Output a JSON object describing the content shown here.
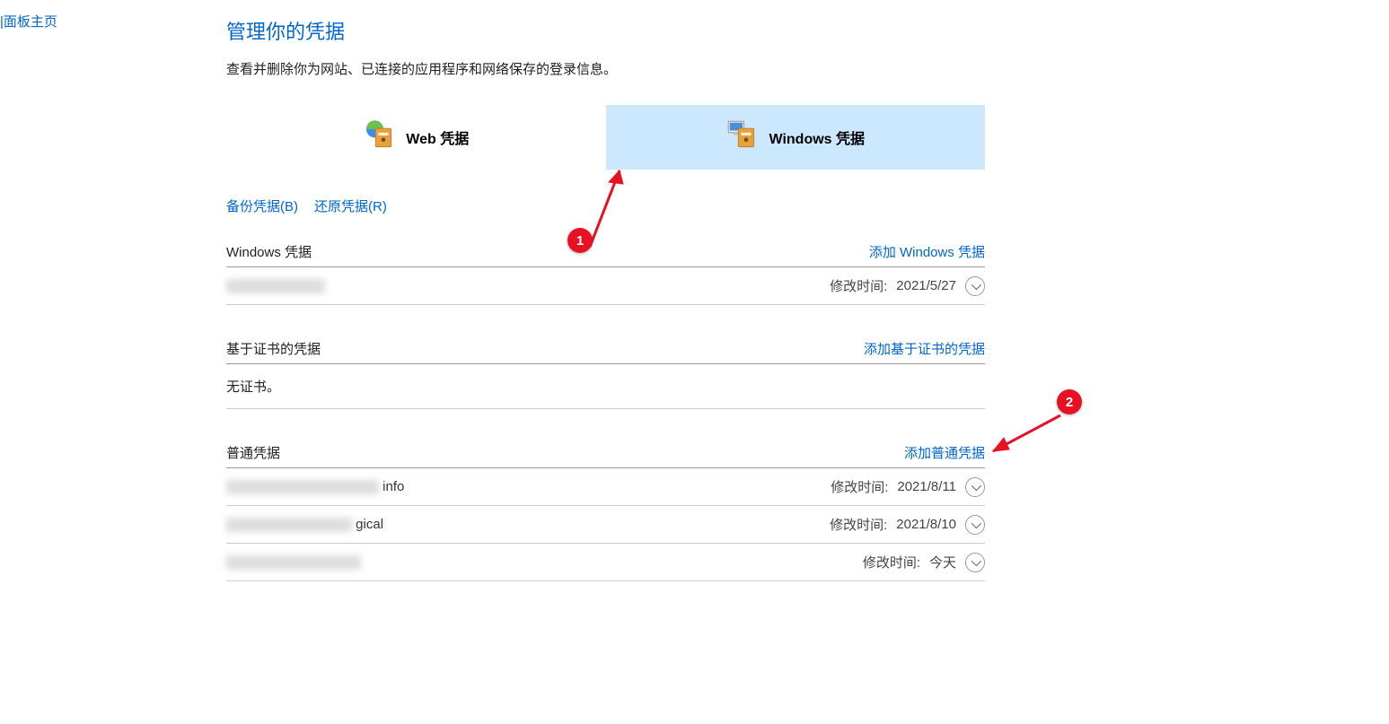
{
  "sidebar": {
    "home_label": "|面板主页"
  },
  "header": {
    "title": "管理你的凭据",
    "subtitle": "查看并删除你为网站、已连接的应用程序和网络保存的登录信息。"
  },
  "tabs": {
    "web": {
      "label": "Web 凭据"
    },
    "windows": {
      "label": "Windows 凭据",
      "selected": true
    }
  },
  "actions": {
    "backup": "备份凭据(B)",
    "restore": "还原凭据(R)"
  },
  "sections": {
    "windows_creds": {
      "title": "Windows 凭据",
      "add_label": "添加 Windows 凭据",
      "rows": [
        {
          "name_suffix": "",
          "modified_label": "修改时间:",
          "modified_value": "2021/5/27"
        }
      ]
    },
    "cert_creds": {
      "title": "基于证书的凭据",
      "add_label": "添加基于证书的凭据",
      "empty_text": "无证书。"
    },
    "generic_creds": {
      "title": "普通凭据",
      "add_label": "添加普通凭据",
      "rows": [
        {
          "name_suffix": "info",
          "modified_label": "修改时间:",
          "modified_value": "2021/8/11"
        },
        {
          "name_suffix": "gical",
          "modified_label": "修改时间:",
          "modified_value": "2021/8/10"
        },
        {
          "name_suffix": "",
          "modified_label": "修改时间:",
          "modified_value": "今天"
        }
      ]
    }
  },
  "annotations": {
    "badge1": "1",
    "badge2": "2"
  }
}
